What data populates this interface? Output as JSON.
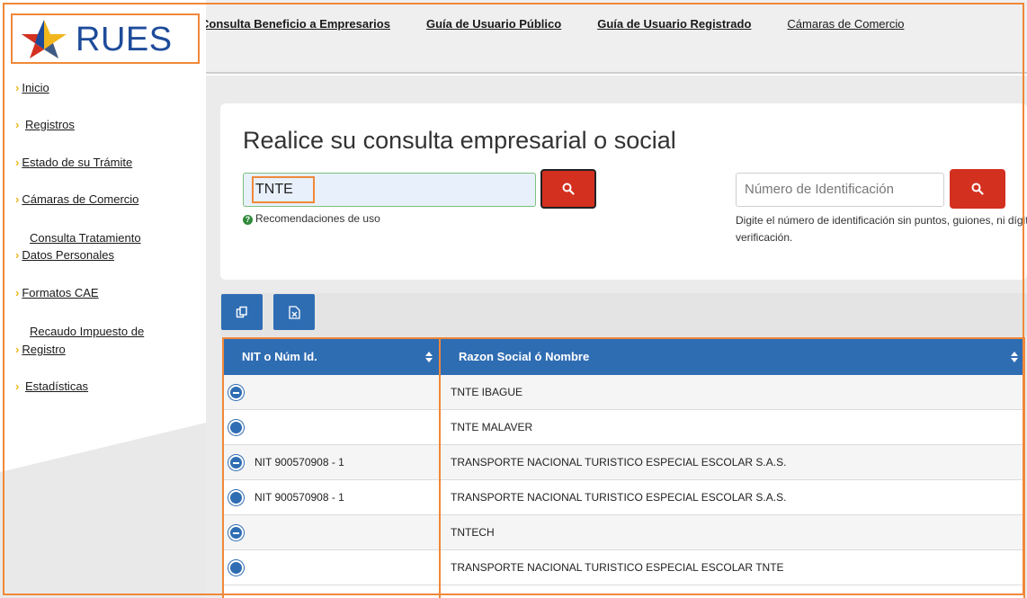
{
  "brand": {
    "name": "RUES",
    "colors": {
      "blue": "#1e4b9a",
      "yellow": "#f2b61c",
      "red": "#d3301f"
    }
  },
  "topnav": [
    {
      "label": "Consulta Beneficio a Empresarios"
    },
    {
      "label": "Guía de Usuario Público"
    },
    {
      "label": "Guía de Usuario Registrado"
    },
    {
      "label": "Cámaras de Comercio"
    }
  ],
  "sidebar": {
    "items": [
      {
        "label": "Inicio"
      },
      {
        "label": "Registros"
      },
      {
        "label": "Estado de su Trámite"
      },
      {
        "label": "Cámaras de Comercio"
      },
      {
        "label_line1": "Consulta Tratamiento",
        "label_line2": "Datos Personales"
      },
      {
        "label": "Formatos CAE"
      },
      {
        "label_line1": "Recaudo Impuesto de",
        "label_line2": "Registro"
      },
      {
        "label": "Estadísticas"
      }
    ]
  },
  "search": {
    "title": "Realice su consulta empresarial o social",
    "value": "TNTE",
    "hint": "Recomendaciones de uso",
    "search_icon": "search-icon"
  },
  "id_search": {
    "placeholder": "Número de Identificación",
    "hint_line1": "Digite el número de identificación sin puntos, guiones, ni dígito de",
    "hint_line2": "verificación."
  },
  "toolbar": {
    "copy_icon": "copy-icon",
    "excel_icon": "excel-icon"
  },
  "table": {
    "headers": [
      "NIT o Núm Id.",
      "Razon Social ó Nombre"
    ],
    "rows": [
      {
        "nit": "",
        "name": "TNTE IBAGUE",
        "icon": "minus"
      },
      {
        "nit": "",
        "name": "TNTE MALAVER",
        "icon": "plus"
      },
      {
        "nit": "NIT 900570908 - 1",
        "name": "TRANSPORTE NACIONAL TURISTICO ESPECIAL ESCOLAR S.A.S.",
        "icon": "minus"
      },
      {
        "nit": "NIT 900570908 - 1",
        "name": "TRANSPORTE NACIONAL TURISTICO ESPECIAL ESCOLAR S.A.S.",
        "icon": "plus"
      },
      {
        "nit": "",
        "name": "TNTECH",
        "icon": "minus"
      },
      {
        "nit": "",
        "name": "TRANSPORTE NACIONAL TURISTICO ESPECIAL ESCOLAR TNTE",
        "icon": "plus"
      }
    ]
  }
}
